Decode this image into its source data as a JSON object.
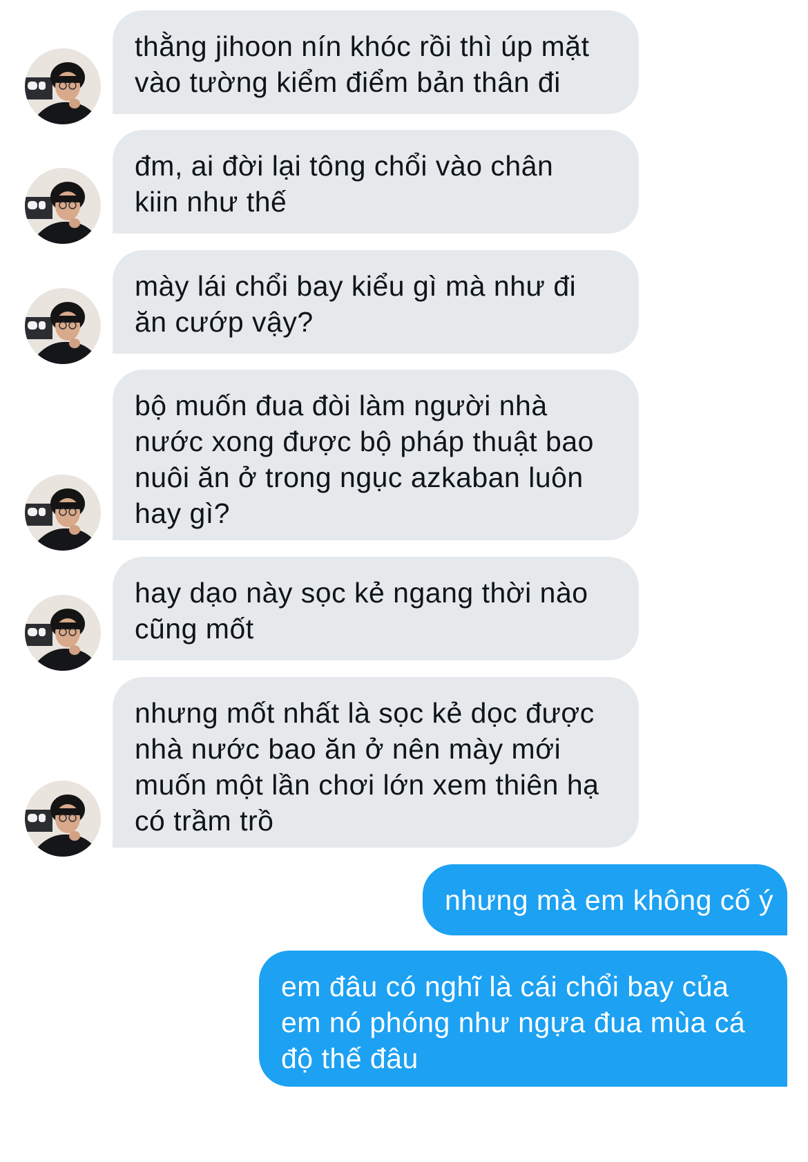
{
  "colors": {
    "incoming_bubble": "#E6E9EC",
    "incoming_text": "#0F1419",
    "outgoing_bubble": "#1DA1F2",
    "outgoing_text": "#FFFFFF"
  },
  "avatar_icon": "profile-photo-icon",
  "messages": [
    {
      "direction": "incoming",
      "text": "thằng jihoon nín khóc rồi thì úp mặt\nvào tường kiểm điểm bản thân đi"
    },
    {
      "direction": "incoming",
      "text": "đm, ai đời lại tông chổi vào chân\nkiin như thế"
    },
    {
      "direction": "incoming",
      "text": "mày lái chổi bay kiểu gì mà như đi\năn cướp vậy?"
    },
    {
      "direction": "incoming",
      "text": "bộ muốn đua đòi làm người nhà\nnước xong được bộ pháp thuật bao\nnuôi ăn ở trong ngục azkaban luôn\nhay gì?"
    },
    {
      "direction": "incoming",
      "text": "hay dạo này sọc kẻ ngang thời nào\ncũng mốt"
    },
    {
      "direction": "incoming",
      "text": "nhưng mốt nhất là sọc kẻ dọc được\nnhà nước bao ăn ở nên mày mới\nmuốn một lần chơi lớn xem thiên hạ\ncó trầm trồ"
    },
    {
      "direction": "outgoing",
      "text": "nhưng mà em không cố ý"
    },
    {
      "direction": "outgoing",
      "text": "em đâu có nghĩ là cái chổi bay của\nem nó phóng như ngựa đua mùa cá\nđộ thế đâu"
    }
  ]
}
